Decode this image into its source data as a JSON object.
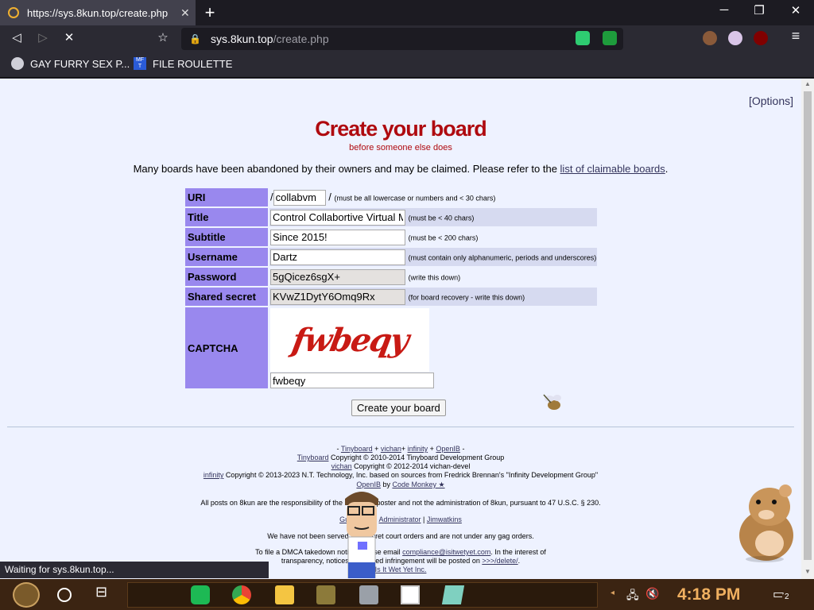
{
  "browser": {
    "tab_title": "https://sys.8kun.top/create.php",
    "tab_close": "✕",
    "new_tab": "+",
    "minimize": "─",
    "maximize": "❐",
    "close": "✕",
    "back": "◁",
    "forward": "▷",
    "reload": "✕",
    "bookmark_star": "☆",
    "url_host": "sys.8kun.top",
    "url_path": "/create.php",
    "menu": "≡",
    "bookmarks": [
      "GAY FURRY SEX P...",
      "FILE ROULETTE"
    ],
    "bookmark2_icon_text": "MF T",
    "status": "Waiting for sys.8kun.top..."
  },
  "page": {
    "options_link": "[Options]",
    "title": "Create your board",
    "subtitle": "before someone else does",
    "notice_text": "Many boards have been abandoned by their owners and may be claimed. Please refer to the ",
    "notice_link": "list of claimable boards",
    "notice_end": ".",
    "form": {
      "uri_label": "URI",
      "uri_prefix": "/",
      "uri_value": "collabvm",
      "uri_suffix": "/",
      "uri_hint": "(must be all lowercase or numbers and < 30 chars)",
      "title_label": "Title",
      "title_value": "Control Collabortive Virtual Machines",
      "title_hint": "(must be < 40 chars)",
      "subtitle_label": "Subtitle",
      "subtitle_value": "Since 2015!",
      "subtitle_hint": "(must be < 200 chars)",
      "username_label": "Username",
      "username_value": "Dartz",
      "username_hint": "(must contain only alphanumeric, periods and underscores)",
      "password_label": "Password",
      "password_value": "5gQicez6sgX+",
      "password_hint": "(write this down)",
      "secret_label": "Shared secret",
      "secret_value": "KVwZ1DytY6Omq9Rx",
      "secret_hint": "(for board recovery - write this down)",
      "captcha_label": "CAPTCHA",
      "captcha_image_text": "fwbeqy",
      "captcha_value": "fwbeqy",
      "submit_label": "Create your board"
    },
    "footer": {
      "l1_a": "- ",
      "l1_tinyboard": "Tinyboard",
      "l1_plus1": " + ",
      "l1_vichan": "vichan",
      "l1_plus2": "+ ",
      "l1_infinity": "infinity",
      "l1_plus3": " + ",
      "l1_openib": "OpenIB",
      "l1_end": " -",
      "l2_link": "Tinyboard",
      "l2_text": " Copyright © 2010-2014 Tinyboard Development Group",
      "l3_link": "vichan",
      "l3_text": " Copyright © 2012-2014 vichan-devel",
      "l4_link": "infinity",
      "l4_text": " Copyright © 2013-2023 N.T. Technology, Inc. based on sources from Fredrick Brennan's \"Infinity Development Group\"",
      "l5_link1": "OpenIB",
      "l5_by": " by ",
      "l5_link2": "Code Monkey ★",
      "l6": "All posts on 8kun are the responsibility of the individual poster and not the administration of 8kun, pursuant to 47 U.S.C. § 230.",
      "l7_link1": "Guidelines",
      "l7_sep1": " | ",
      "l7_link2": "Administrator",
      "l7_sep2": " | ",
      "l7_link3": "Jimwatkins",
      "l8": "We have not been served any secret court orders and are not under any gag orders.",
      "l9_text": "To file a DMCA takedown notice, please email ",
      "l9_link": "compliance@isitwetyet.com",
      "l9_end": ". In the interest of",
      "l10_text": "transparency, notices of claimed infringement will be posted on ",
      "l10_link": ">>>/delete/",
      "l10_end": ".",
      "l11_link": "Is It Wet Yet Inc."
    }
  },
  "taskbar": {
    "clock": "4:18 PM",
    "notification_count": "2"
  }
}
